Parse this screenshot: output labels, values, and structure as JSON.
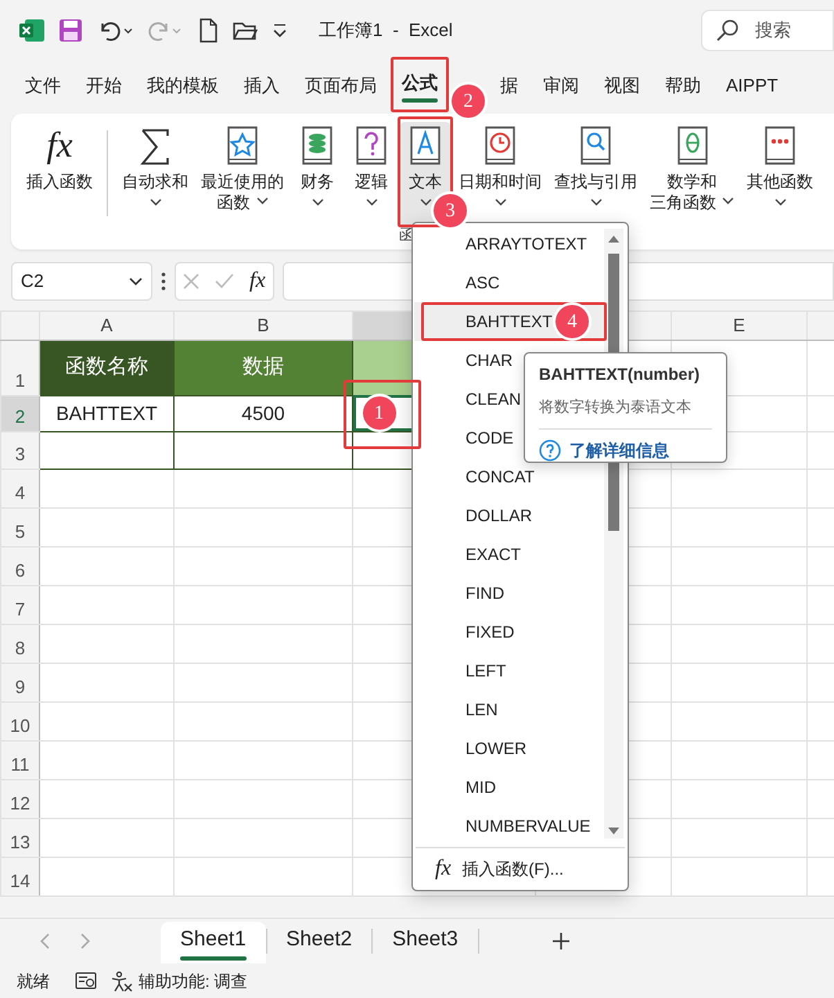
{
  "title_bar": {
    "title": "工作簿1  -  Excel",
    "search_placeholder": "搜索"
  },
  "menu_tabs": [
    {
      "label": "文件",
      "selected": false
    },
    {
      "label": "开始",
      "selected": false
    },
    {
      "label": "我的模板",
      "selected": false
    },
    {
      "label": "插入",
      "selected": false
    },
    {
      "label": "页面布局",
      "selected": false
    },
    {
      "label": "公式",
      "selected": true,
      "annotation": "2"
    },
    {
      "label": "据",
      "selected": false
    },
    {
      "label": "审阅",
      "selected": false
    },
    {
      "label": "视图",
      "selected": false
    },
    {
      "label": "帮助",
      "selected": false
    },
    {
      "label": "AIPPT",
      "selected": false
    }
  ],
  "ribbon": {
    "group_label": "函",
    "buttons": [
      {
        "kind": "fx",
        "icon_text": "fx",
        "lines": [
          "插入函数"
        ],
        "dropdown": false,
        "pressed": false
      },
      {
        "kind": "sum",
        "lines": [
          "自动求和"
        ],
        "dropdown": true,
        "pressed": false
      },
      {
        "kind": "star",
        "lines": [
          "最近使用的",
          "函数"
        ],
        "dropdown": true,
        "pressed": false
      },
      {
        "kind": "coins",
        "lines": [
          "财务"
        ],
        "dropdown": true,
        "pressed": false
      },
      {
        "kind": "question",
        "lines": [
          "逻辑"
        ],
        "dropdown": true,
        "pressed": false
      },
      {
        "kind": "letter",
        "lines": [
          "文本"
        ],
        "dropdown": true,
        "pressed": true,
        "annotation": "3"
      },
      {
        "kind": "clock",
        "lines": [
          "日期和时间"
        ],
        "dropdown": true,
        "pressed": false
      },
      {
        "kind": "magnifier",
        "lines": [
          "查找与引用"
        ],
        "dropdown": true,
        "pressed": false
      },
      {
        "kind": "theta",
        "lines": [
          "数学和",
          "三角函数"
        ],
        "dropdown": true,
        "pressed": false
      },
      {
        "kind": "dots",
        "lines": [
          "其他函数"
        ],
        "dropdown": true,
        "pressed": false
      }
    ]
  },
  "formula_bar": {
    "name_box": "C2",
    "fx": "fx"
  },
  "columns": [
    {
      "label": "A",
      "selected": false
    },
    {
      "label": "B",
      "selected": false
    },
    {
      "selected": true
    },
    {
      "selected": false
    },
    {
      "label": "E",
      "selected": false
    }
  ],
  "rows": [
    {
      "number": "1",
      "selected": false,
      "cells": [
        {
          "kind": "title_dark",
          "text": "函数名称"
        },
        {
          "kind": "title",
          "text": "数据"
        },
        {
          "kind": "title_light"
        }
      ]
    },
    {
      "number": "2",
      "selected": true,
      "cells": [
        {
          "kind": "plain",
          "text": "BAHTTEXT"
        },
        {
          "kind": "plain",
          "text": "4500"
        },
        {
          "kind": "plain",
          "selected": true,
          "annotation": "1"
        }
      ]
    },
    {
      "number": "3",
      "selected": false,
      "cells": [
        {
          "kind": "plain"
        },
        {
          "kind": "plain"
        },
        {
          "kind": "plain"
        }
      ]
    },
    {
      "number": "4",
      "selected": false
    },
    {
      "number": "5",
      "selected": false
    },
    {
      "number": "6",
      "selected": false
    },
    {
      "number": "7",
      "selected": false
    },
    {
      "number": "8",
      "selected": false
    },
    {
      "number": "9",
      "selected": false
    },
    {
      "number": "10",
      "selected": false
    },
    {
      "number": "11",
      "selected": false
    },
    {
      "number": "12",
      "selected": false
    },
    {
      "number": "13",
      "selected": false
    },
    {
      "number": "14",
      "selected": false
    }
  ],
  "function_menu": {
    "items": [
      {
        "label": "ARRAYTOTEXT",
        "selected": false
      },
      {
        "label": "ASC",
        "selected": false
      },
      {
        "label": "BAHTTEXT",
        "selected": true,
        "annotation": "4"
      },
      {
        "label": "CHAR",
        "selected": false
      },
      {
        "label": "CLEAN",
        "selected": false
      },
      {
        "label": "CODE",
        "selected": false
      },
      {
        "label": "CONCAT",
        "selected": false
      },
      {
        "label": "DOLLAR",
        "selected": false
      },
      {
        "label": "EXACT",
        "selected": false
      },
      {
        "label": "FIND",
        "selected": false
      },
      {
        "label": "FIXED",
        "selected": false
      },
      {
        "label": "LEFT",
        "selected": false
      },
      {
        "label": "LEN",
        "selected": false
      },
      {
        "label": "LOWER",
        "selected": false
      },
      {
        "label": "MID",
        "selected": false
      },
      {
        "label": "NUMBERVALUE",
        "selected": false
      }
    ],
    "footer_icon_text": "fx",
    "footer": "插入函数(F)..."
  },
  "tooltip": {
    "title": "BAHTTEXT(number)",
    "description": "将数字转换为泰语文本",
    "link": "了解详细信息"
  },
  "sheet_tabs": [
    {
      "label": "Sheet1",
      "selected": true
    },
    {
      "label": "Sheet2",
      "selected": false
    },
    {
      "label": "Sheet3",
      "selected": false
    }
  ],
  "status_bar": {
    "status": "就绪",
    "accessibility": "辅助功能: 调查"
  }
}
